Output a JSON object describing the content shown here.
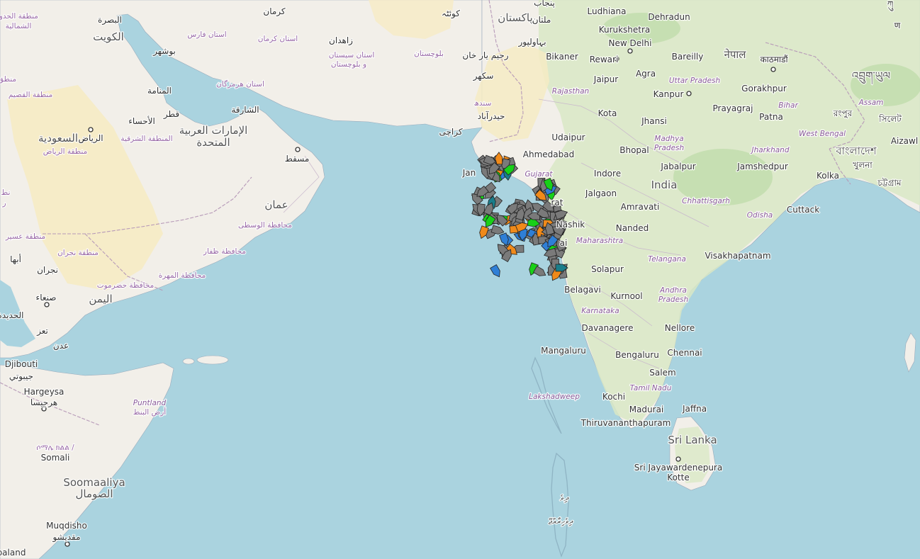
{
  "colors": {
    "sea": "#aad3df",
    "land": "#f2efe9",
    "desert": "#f6ebc4",
    "green_land": "#d9e8c6",
    "forest": "#b7d8a2",
    "border": "#b79ab8",
    "vessel_default": "#7a7a7a",
    "vessel_green": "#18d018",
    "vessel_orange": "#f08a1a",
    "vessel_blue": "#2f7fd6",
    "vessel_teal": "#1a7d8a"
  },
  "labels": {
    "en": [
      {
        "name": "ludhiana",
        "text": "Ludhiana"
      },
      {
        "name": "dehradun",
        "text": "Dehradun"
      },
      {
        "name": "kurukshetra",
        "text": "Kurukshetra"
      },
      {
        "name": "new-delhi",
        "text": "New Delhi"
      },
      {
        "name": "bikaner",
        "text": "Bikaner"
      },
      {
        "name": "rewari",
        "text": "Rewari"
      },
      {
        "name": "bareilly",
        "text": "Bareilly"
      },
      {
        "name": "jaipur",
        "text": "Jaipur"
      },
      {
        "name": "agra",
        "text": "Agra"
      },
      {
        "name": "kanpur",
        "text": "Kanpur"
      },
      {
        "name": "gorakhpur",
        "text": "Gorakhpur"
      },
      {
        "name": "prayagraj",
        "text": "Prayagraj"
      },
      {
        "name": "kota",
        "text": "Kota"
      },
      {
        "name": "patna",
        "text": "Patna"
      },
      {
        "name": "jhansi",
        "text": "Jhansi"
      },
      {
        "name": "udaipur",
        "text": "Udaipur"
      },
      {
        "name": "ahmedabad",
        "text": "Ahmedabad"
      },
      {
        "name": "bhopal",
        "text": "Bhopal"
      },
      {
        "name": "indore",
        "text": "Indore"
      },
      {
        "name": "jabalpur",
        "text": "Jabalpur"
      },
      {
        "name": "jamshedpur",
        "text": "Jamshedpur"
      },
      {
        "name": "kolkata",
        "text": "Kolka"
      },
      {
        "name": "aizawl",
        "text": "Aizawl"
      },
      {
        "name": "jalgaon",
        "text": "Jalgaon"
      },
      {
        "name": "amravati",
        "text": "Amravati"
      },
      {
        "name": "cuttack",
        "text": "Cuttack"
      },
      {
        "name": "nashik",
        "text": "Nashik"
      },
      {
        "name": "nanded",
        "text": "Nanded"
      },
      {
        "name": "visakhapatnam",
        "text": "Visakhapatnam"
      },
      {
        "name": "solapur",
        "text": "Solapur"
      },
      {
        "name": "belagavi",
        "text": "Belagavi"
      },
      {
        "name": "kurnool",
        "text": "Kurnool"
      },
      {
        "name": "davanagere",
        "text": "Davanagere"
      },
      {
        "name": "nellore",
        "text": "Nellore"
      },
      {
        "name": "mangaluru",
        "text": "Mangaluru"
      },
      {
        "name": "bengaluru",
        "text": "Bengaluru"
      },
      {
        "name": "chennai",
        "text": "Chennai"
      },
      {
        "name": "salem",
        "text": "Salem"
      },
      {
        "name": "kochi",
        "text": "Kochi"
      },
      {
        "name": "madurai",
        "text": "Madurai"
      },
      {
        "name": "jaffna",
        "text": "Jaffna"
      },
      {
        "name": "thiruvananthapuram",
        "text": "Thiruvananthapuram"
      },
      {
        "name": "sri-jayawardenepura",
        "text": "Sri Jayawardenepura"
      },
      {
        "name": "kotte",
        "text": "Kotte"
      },
      {
        "name": "hargeysa",
        "text": "Hargeysa"
      },
      {
        "name": "somali-label",
        "text": "Somali"
      },
      {
        "name": "muqdisho",
        "text": "Muqdisho"
      },
      {
        "name": "djibouti",
        "text": "Djibouti"
      },
      {
        "name": "jam-partial",
        "text": "Jan"
      },
      {
        "name": "surat-partial",
        "text": "rat"
      },
      {
        "name": "mumbai-partial",
        "text": "ai"
      },
      {
        "name": "somaliland-partial",
        "text": "baland"
      }
    ],
    "countries": [
      {
        "name": "india-label",
        "text": "India"
      },
      {
        "name": "sri-lanka-label",
        "text": "Sri Lanka"
      },
      {
        "name": "somaalia-label",
        "text": "Soomaaliya"
      },
      {
        "name": "nepal-label",
        "text": "नेपाल"
      },
      {
        "name": "bangladesh-label",
        "text": "বাংলাদেশ"
      },
      {
        "name": "bhutan-label",
        "text": "འབྲུག་ཡུལ"
      },
      {
        "name": "pakistan-label",
        "text": "پاکستان"
      },
      {
        "name": "oman-label",
        "text": "عمان"
      },
      {
        "name": "uae-label-1",
        "text": "الإمارات العربية"
      },
      {
        "name": "uae-label-2",
        "text": "المتحدة"
      },
      {
        "name": "saudi-label",
        "text": "السعودية"
      },
      {
        "name": "yemen-label",
        "text": "اليمن"
      },
      {
        "name": "kuwait-label",
        "text": "الكويت"
      },
      {
        "name": "somalia-ar-label",
        "text": "الصومال"
      }
    ],
    "regions": [
      {
        "name": "rajasthan",
        "text": "Rajasthan"
      },
      {
        "name": "uttar-pradesh",
        "text": "Uttar Pradesh"
      },
      {
        "name": "bihar",
        "text": "Bihar"
      },
      {
        "name": "assam",
        "text": "Assam"
      },
      {
        "name": "madhya-pradesh-1",
        "text": "Madhya"
      },
      {
        "name": "madhya-pradesh-2",
        "text": "Pradesh"
      },
      {
        "name": "west-bengal",
        "text": "West Bengal"
      },
      {
        "name": "jharkhand",
        "text": "Jharkhand"
      },
      {
        "name": "gujarat",
        "text": "Gujarat"
      },
      {
        "name": "chhattisgarh",
        "text": "Chhattisgarh"
      },
      {
        "name": "odisha",
        "text": "Odisha"
      },
      {
        "name": "maharashtra",
        "text": "Maharashtra"
      },
      {
        "name": "telangana",
        "text": "Telangana"
      },
      {
        "name": "andhra-1",
        "text": "Andhra"
      },
      {
        "name": "andhra-2",
        "text": "Pradesh"
      },
      {
        "name": "karnataka",
        "text": "Karnataka"
      },
      {
        "name": "tamil-nadu",
        "text": "Tamil Nadu"
      },
      {
        "name": "lakshadweep",
        "text": "Lakshadweep"
      },
      {
        "name": "puntland-1",
        "text": "Puntland"
      }
    ],
    "arabic": [
      {
        "name": "basra",
        "text": "البصرة"
      },
      {
        "name": "kerman",
        "text": "كرمان"
      },
      {
        "name": "quetta",
        "text": "كوئٹہ"
      },
      {
        "name": "multan",
        "text": "ملتان"
      },
      {
        "name": "bahawalpur",
        "text": "بہاولپور"
      },
      {
        "name": "punjab-pk",
        "text": "پنجاب"
      },
      {
        "name": "northern-region-1",
        "text": "منطقة الحدود"
      },
      {
        "name": "northern-region-2",
        "text": "الشمالية"
      },
      {
        "name": "fars",
        "text": "استان فارس"
      },
      {
        "name": "kerman-province",
        "text": "استان کرمان"
      },
      {
        "name": "bushehr",
        "text": "بوشهر"
      },
      {
        "name": "zahedan",
        "text": "زاهدان"
      },
      {
        "name": "sistan-1",
        "text": "استان سیستان"
      },
      {
        "name": "sistan-2",
        "text": "و بلوچستان"
      },
      {
        "name": "balochistan",
        "text": "بلوچستان"
      },
      {
        "name": "rahim-yar-khan",
        "text": "رحیم یار خان"
      },
      {
        "name": "sukkur",
        "text": "سکھر"
      },
      {
        "name": "hormozgan",
        "text": "استان هرمزگان"
      },
      {
        "name": "manama",
        "text": "المنامة"
      },
      {
        "name": "qassim",
        "text": "منطقة القصيم"
      },
      {
        "name": "sharjah",
        "text": "الشارقة"
      },
      {
        "name": "sindh",
        "text": "سندھ"
      },
      {
        "name": "hyderabad-pk",
        "text": "حیدرآباد"
      },
      {
        "name": "qatar",
        "text": "قطر"
      },
      {
        "name": "ahsa",
        "text": "الأحساء"
      },
      {
        "name": "karachi",
        "text": "کراچی"
      },
      {
        "name": "riyadh",
        "text": "الرياض"
      },
      {
        "name": "eastern-province",
        "text": "المنطقة الشرقية"
      },
      {
        "name": "riyadh-region",
        "text": "منطقة الرياض"
      },
      {
        "name": "muscat",
        "text": "مسقط"
      },
      {
        "name": "wusta",
        "text": "محافظة الوسطى"
      },
      {
        "name": "asir",
        "text": "منطقة عسير"
      },
      {
        "name": "najran-region",
        "text": "منطقة نجران"
      },
      {
        "name": "dhofar",
        "text": "محافظة ظفار"
      },
      {
        "name": "abha",
        "text": "أبها"
      },
      {
        "name": "najran",
        "text": "نجران"
      },
      {
        "name": "mahra",
        "text": "محافظة المهرة"
      },
      {
        "name": "hadramaut",
        "text": "محافظة حضرموت"
      },
      {
        "name": "sanaa",
        "text": "صنعاء"
      },
      {
        "name": "hudaydah",
        "text": "الحديدة"
      },
      {
        "name": "taiz",
        "text": "تعز"
      },
      {
        "name": "aden",
        "text": "عدن"
      },
      {
        "name": "djibouti-ar",
        "text": "جيبوتي"
      },
      {
        "name": "hargeysa-ar",
        "text": "هرجيسا"
      },
      {
        "name": "puntland-ar",
        "text": "أرض البنط"
      },
      {
        "name": "somali-ethiopic",
        "text": "ሶማሌ ክልል /"
      },
      {
        "name": "muqdisho-ar",
        "text": "مقديشو"
      },
      {
        "name": "maldives-1",
        "text": "ދިވެ"
      },
      {
        "name": "maldives-2",
        "text": "ދިވެހިރާއްޖޭ"
      },
      {
        "name": "sylhet",
        "text": "সিলেট"
      },
      {
        "name": "khulna",
        "text": "খুলনা"
      },
      {
        "name": "chittagong",
        "text": "চট্টগ্রাম"
      },
      {
        "name": "kathmandu",
        "text": "काठमाडौं"
      },
      {
        "name": "rangpur",
        "text": "রংপুর"
      },
      {
        "name": "lhasa-partial",
        "text": "ཀུ"
      },
      {
        "name": "hiregion",
        "text": "ण"
      },
      {
        "name": "al-partial-1",
        "text": "منطق"
      },
      {
        "name": "al-partial-2",
        "text": "نط"
      },
      {
        "name": "al-partial-3",
        "text": "ر"
      }
    ]
  }
}
